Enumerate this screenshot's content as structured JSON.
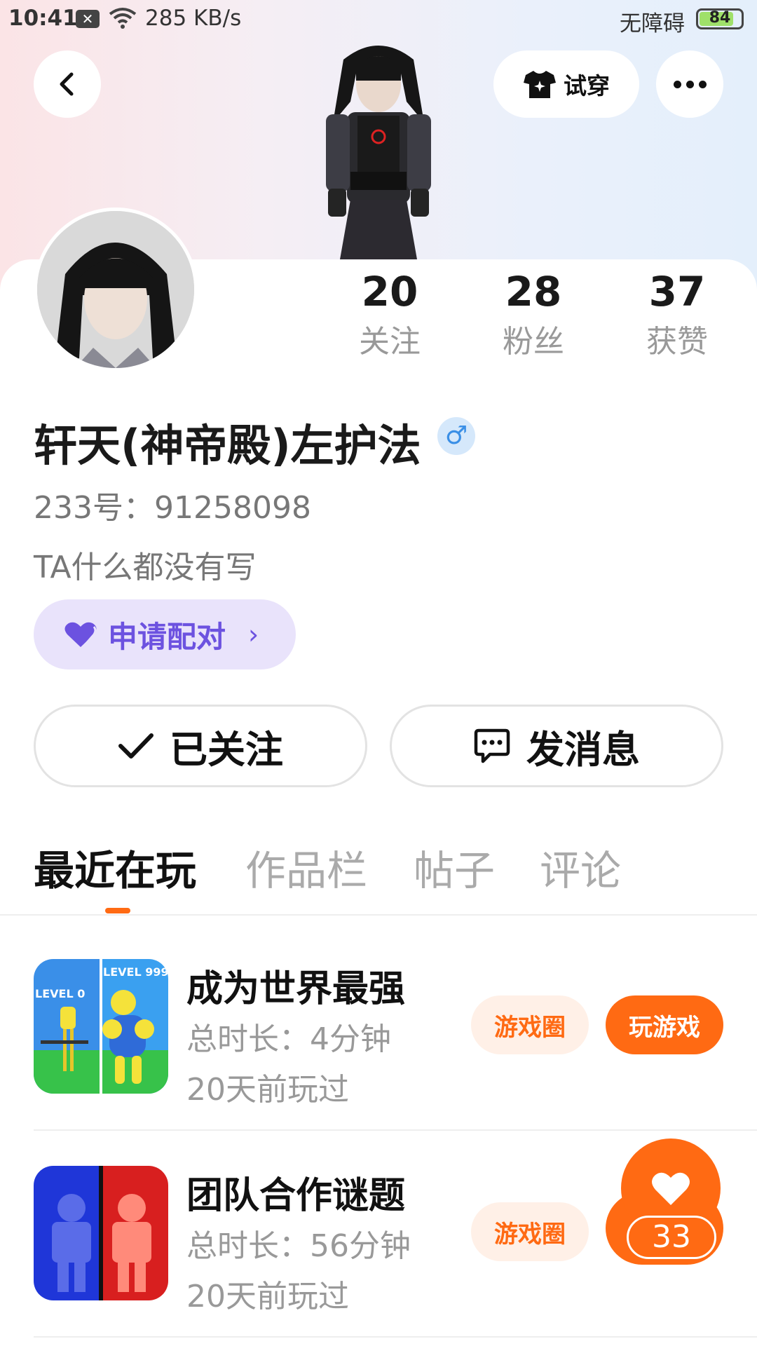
{
  "status_bar": {
    "time": "10:41",
    "net_speed": "285 KB/s",
    "accessibility": "无障碍",
    "battery": "84",
    "battery_level": 0.84
  },
  "header": {
    "tryon_label": "试穿"
  },
  "stats": [
    {
      "value": "20",
      "label": "关注"
    },
    {
      "value": "28",
      "label": "粉丝"
    },
    {
      "value": "37",
      "label": "获赞"
    }
  ],
  "profile": {
    "username": "轩天(神帝殿)左护法",
    "gender_symbol": "♂",
    "user_id": "233号：91258098",
    "bio": "TA什么都没有写",
    "pair_label": "申请配对"
  },
  "actions": {
    "follow_label": "已关注",
    "message_label": "发消息"
  },
  "tabs": [
    "最近在玩",
    "作品栏",
    "帖子",
    "评论"
  ],
  "games": [
    {
      "title": "成为世界最强",
      "duration": "总时长：4分钟",
      "last_played": "20天前玩过",
      "circle_label": "游戏圈",
      "play_label": "玩游戏",
      "icon_text_a": "LEVEL 0",
      "icon_text_b": "LEVEL 999"
    },
    {
      "title": "团队合作谜题",
      "duration": "总时长：56分钟",
      "last_played": "20天前玩过",
      "circle_label": "游戏圈"
    }
  ],
  "like_count": "33",
  "colors": {
    "accent": "#ff6a13",
    "pair_purple": "#6c52e0",
    "gender_blue": "#3a8fe6"
  }
}
